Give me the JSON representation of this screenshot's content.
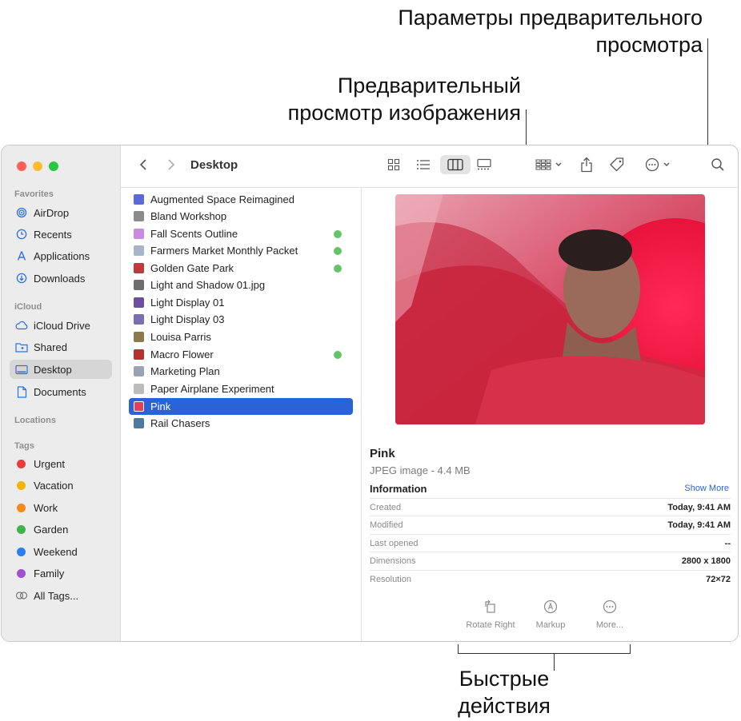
{
  "callouts": {
    "preview_options": [
      "Параметры предварительного",
      "просмотра"
    ],
    "image_preview": [
      "Предварительный",
      "просмотр изображения"
    ],
    "quick_actions": [
      "Быстрые",
      "действия"
    ]
  },
  "sidebar": {
    "favorites_heading": "Favorites",
    "favorites": [
      {
        "label": "AirDrop",
        "icon": "airdrop-icon"
      },
      {
        "label": "Recents",
        "icon": "clock-icon"
      },
      {
        "label": "Applications",
        "icon": "applications-icon"
      },
      {
        "label": "Downloads",
        "icon": "download-icon"
      }
    ],
    "icloud_heading": "iCloud",
    "icloud": [
      {
        "label": "iCloud Drive",
        "icon": "cloud-icon"
      },
      {
        "label": "Shared",
        "icon": "shared-folder-icon"
      },
      {
        "label": "Desktop",
        "icon": "desktop-icon",
        "selected": true
      },
      {
        "label": "Documents",
        "icon": "document-icon"
      }
    ],
    "locations_heading": "Locations",
    "tags_heading": "Tags",
    "tags": [
      {
        "label": "Urgent",
        "color": "#ec3b3b"
      },
      {
        "label": "Vacation",
        "color": "#f2b400"
      },
      {
        "label": "Work",
        "color": "#f08a1c"
      },
      {
        "label": "Garden",
        "color": "#3cb54a"
      },
      {
        "label": "Weekend",
        "color": "#2a7ff0"
      },
      {
        "label": "Family",
        "color": "#a24fd1"
      }
    ],
    "all_tags": "All Tags..."
  },
  "toolbar": {
    "title": "Desktop"
  },
  "files": [
    {
      "name": "Augmented Space Reimagined",
      "color": "#5b6ad6",
      "tag": false
    },
    {
      "name": "Bland Workshop",
      "color": "#8b8b8b",
      "tag": false
    },
    {
      "name": "Fall Scents Outline",
      "color": "#c98be0",
      "tag": true
    },
    {
      "name": "Farmers Market Monthly Packet",
      "color": "#a9b4c8",
      "tag": true
    },
    {
      "name": "Golden Gate Park",
      "color": "#c0393b",
      "tag": true
    },
    {
      "name": "Light and Shadow 01.jpg",
      "color": "#6e6e6e",
      "tag": false
    },
    {
      "name": "Light Display 01",
      "color": "#6b4f9e",
      "tag": false
    },
    {
      "name": "Light Display 03",
      "color": "#7a6db0",
      "tag": false
    },
    {
      "name": "Louisa Parris",
      "color": "#8c7a4f",
      "tag": false
    },
    {
      "name": "Macro Flower",
      "color": "#b3322e",
      "tag": true
    },
    {
      "name": "Marketing Plan",
      "color": "#9aa3b5",
      "tag": false
    },
    {
      "name": "Paper Airplane Experiment",
      "color": "#bcbcbc",
      "tag": false
    },
    {
      "name": "Pink",
      "color": "#e0405a",
      "tag": false,
      "selected": true
    },
    {
      "name": "Rail Chasers",
      "color": "#4f7aa0",
      "tag": false
    }
  ],
  "preview": {
    "name": "Pink",
    "kind": "JPEG image - 4.4 MB",
    "info_heading": "Information",
    "show_more": "Show More",
    "info": [
      {
        "key": "Created",
        "value": "Today, 9:41 AM"
      },
      {
        "key": "Modified",
        "value": "Today, 9:41 AM"
      },
      {
        "key": "Last opened",
        "value": "--"
      },
      {
        "key": "Dimensions",
        "value": "2800 x 1800"
      },
      {
        "key": "Resolution",
        "value": "72×72"
      }
    ],
    "quick_actions": [
      {
        "label": "Rotate Right",
        "icon": "rotate-right-icon"
      },
      {
        "label": "Markup",
        "icon": "markup-icon"
      },
      {
        "label": "More...",
        "icon": "more-icon"
      }
    ]
  }
}
